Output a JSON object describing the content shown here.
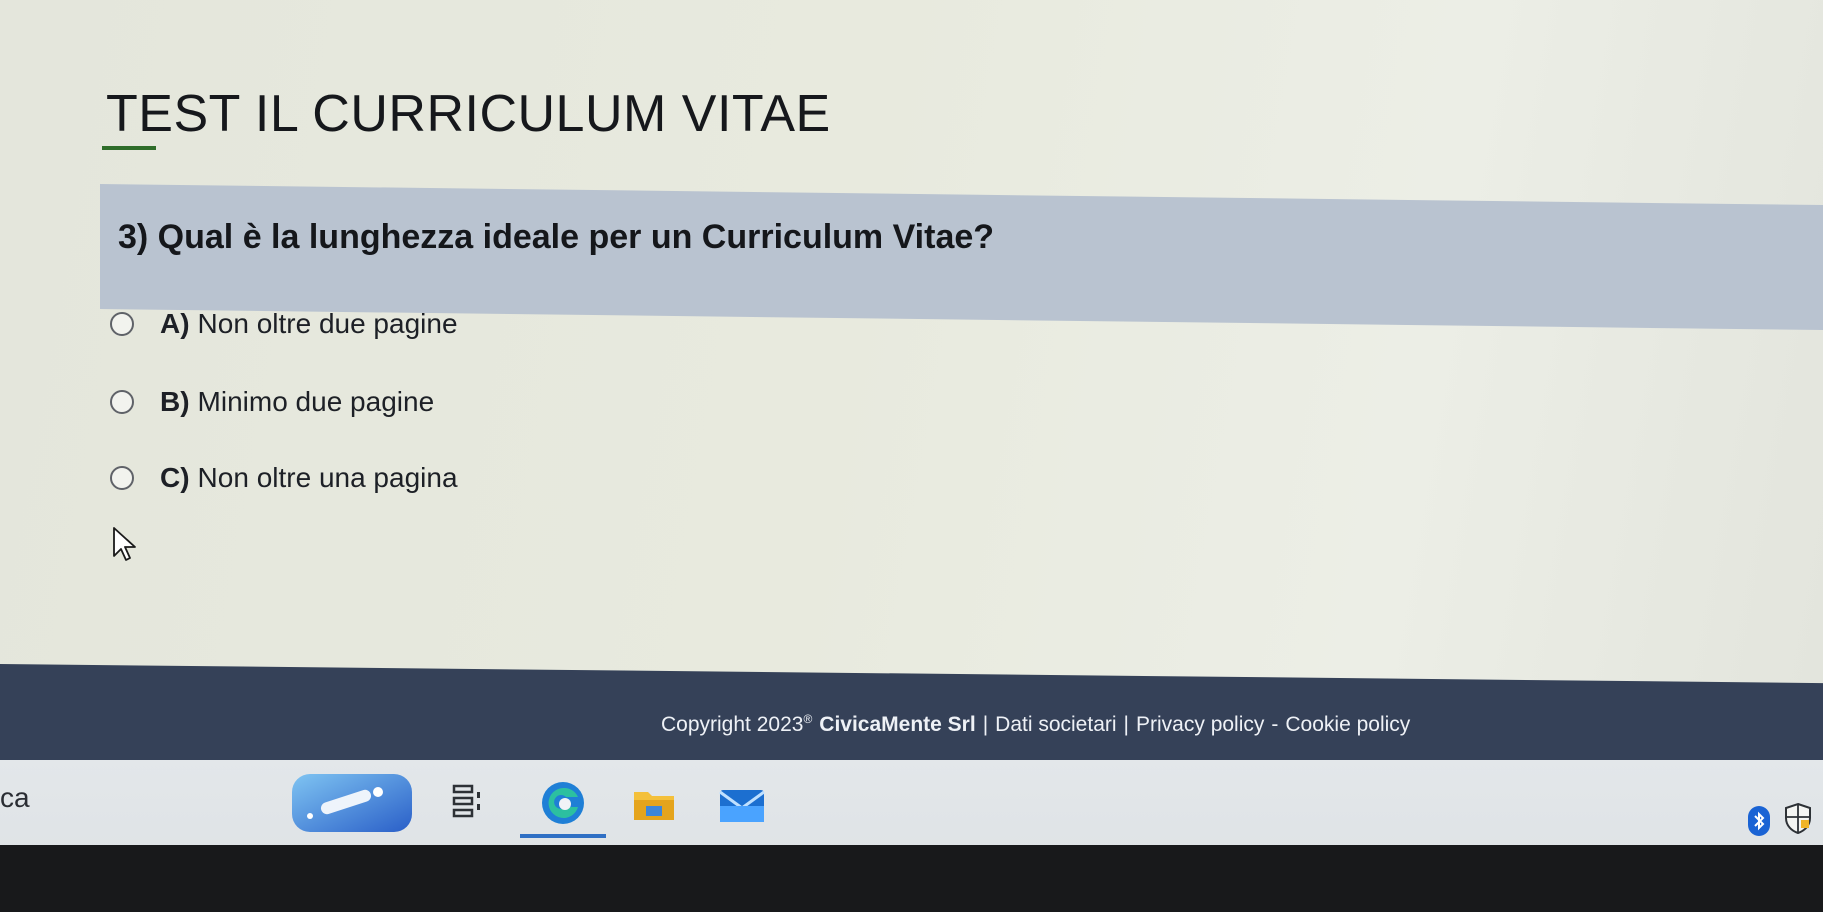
{
  "page": {
    "title": "TEST IL CURRICULUM VITAE"
  },
  "question": {
    "text": "3) Qual è la lunghezza ideale per un Curriculum Vitae?",
    "options": [
      {
        "letter": "A)",
        "text": "Non oltre due pagine"
      },
      {
        "letter": "B)",
        "text": "Minimo due pagine"
      },
      {
        "letter": "C)",
        "text": "Non oltre una pagina"
      }
    ]
  },
  "footer": {
    "copyright": "Copyright 2023",
    "registered_mark": "®",
    "company": "CivicaMente Srl",
    "sep1": "|",
    "dati": "Dati societari",
    "sep2": "|",
    "privacy": "Privacy policy",
    "sep3": "-",
    "cookie": "Cookie policy"
  },
  "taskbar": {
    "search_fragment": "ca",
    "icons": [
      "widgets-icon",
      "task-view-icon",
      "edge-browser-icon",
      "file-explorer-icon",
      "mail-icon",
      "bluetooth-icon",
      "security-shield-icon"
    ]
  },
  "colors": {
    "title_underline": "#2f6d2a",
    "question_bar": "#b9c3d0",
    "footer_bg": "#354158",
    "edge_blue": "#2f6fc4"
  }
}
